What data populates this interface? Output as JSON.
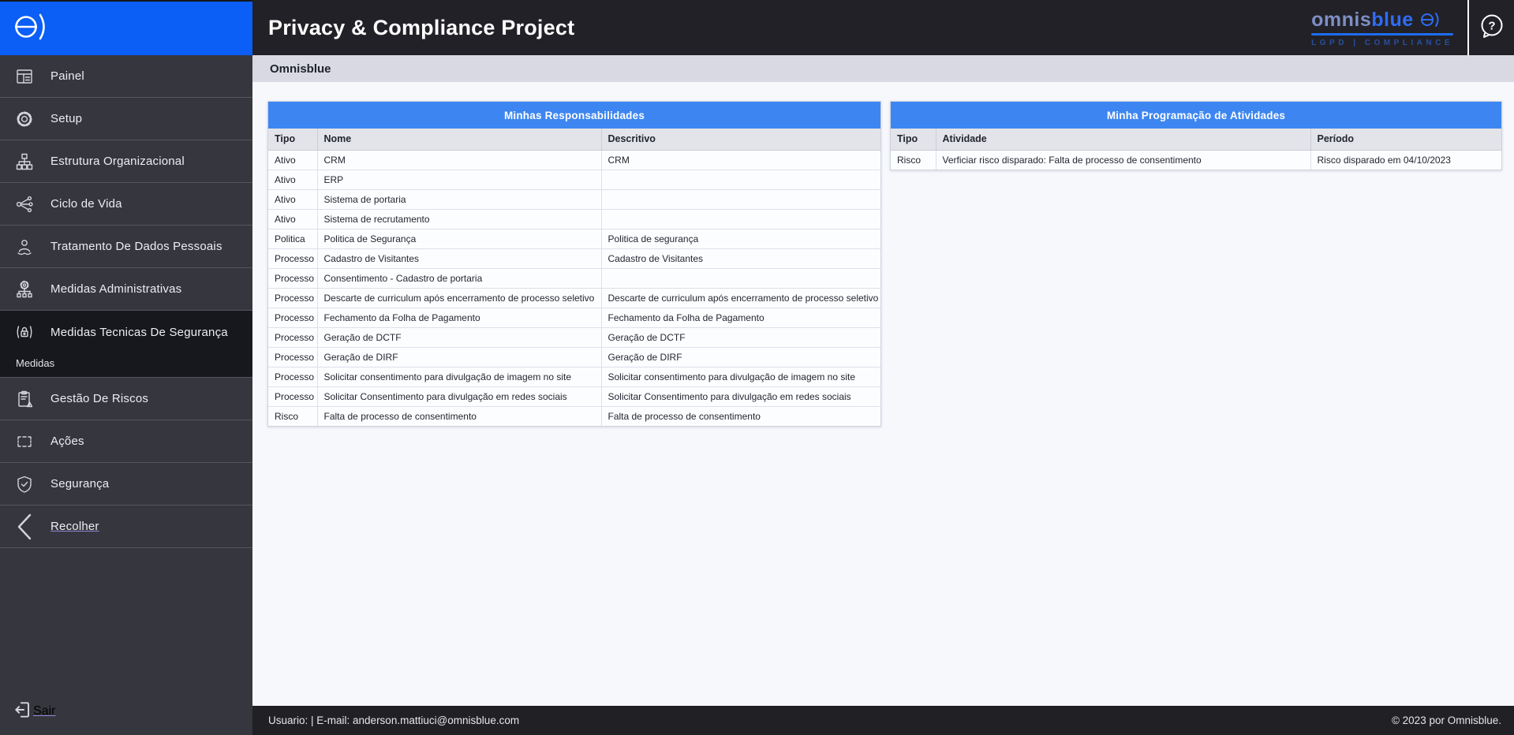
{
  "header": {
    "title": "Privacy & Compliance Project",
    "brand": {
      "name_part1": "omnis",
      "name_part2": "blue",
      "tagline": "LGPD  |  COMPLIANCE"
    }
  },
  "breadcrumb": "Omnisblue",
  "sidebar": {
    "items": [
      {
        "label": "Painel"
      },
      {
        "label": "Setup"
      },
      {
        "label": "Estrutura Organizacional"
      },
      {
        "label": "Ciclo de Vida"
      },
      {
        "label": "Tratamento De Dados Pessoais"
      },
      {
        "label": "Medidas Administrativas"
      },
      {
        "label": "Medidas Tecnicas De Segurança",
        "active": true,
        "subitem": "Medidas"
      },
      {
        "label": "Gestão De Riscos"
      },
      {
        "label": "Ações"
      },
      {
        "label": "Segurança"
      },
      {
        "label": "Recolher"
      },
      {
        "label": "Sair"
      }
    ]
  },
  "tables": [
    {
      "title": "Minhas Responsabilidades",
      "columns": [
        "Tipo",
        "Nome",
        "Descritivo"
      ],
      "rows": [
        [
          "Ativo",
          "CRM",
          "CRM"
        ],
        [
          "Ativo",
          "ERP",
          ""
        ],
        [
          "Ativo",
          "Sistema de portaria",
          ""
        ],
        [
          "Ativo",
          "Sistema de recrutamento",
          ""
        ],
        [
          "Politica",
          "Politica de Segurança",
          "Politica de segurança"
        ],
        [
          "Processo",
          "Cadastro de Visitantes",
          "Cadastro de Visitantes"
        ],
        [
          "Processo",
          "Consentimento - Cadastro de portaria",
          ""
        ],
        [
          "Processo",
          "Descarte de curriculum após encerramento de processo seletivo",
          "Descarte de curriculum após encerramento de processo seletivo"
        ],
        [
          "Processo",
          "Fechamento da Folha de Pagamento",
          "Fechamento da Folha de Pagamento"
        ],
        [
          "Processo",
          "Geração de DCTF",
          "Geração de DCTF"
        ],
        [
          "Processo",
          "Geração de DIRF",
          "Geração de DIRF"
        ],
        [
          "Processo",
          "Solicitar consentimento para divulgação de imagem no site",
          "Solicitar consentimento para divulgação de imagem no site"
        ],
        [
          "Processo",
          "Solicitar Consentimento para divulgação em redes sociais",
          "Solicitar Consentimento para divulgação em redes sociais"
        ],
        [
          "Risco",
          "Falta de processo de consentimento",
          "Falta de processo de consentimento"
        ]
      ]
    },
    {
      "title": "Minha Programação de Atividades",
      "columns": [
        "Tipo",
        "Atividade",
        "Período"
      ],
      "rows": [
        [
          "Risco",
          "Verficiar risco disparado: Falta de processo de consentimento",
          "Risco disparado em 04/10/2023"
        ]
      ]
    }
  ],
  "footer": {
    "user_info": "Usuario: | E-mail: anderson.mattiuci@omnisblue.com",
    "copyright": "© 2023 por Omnisblue."
  },
  "colors": {
    "brand_blue": "#0b5ef6",
    "table_header_blue": "#3d86f1",
    "sidebar_bg": "#36373e",
    "sidebar_active_bg": "#17181d",
    "header_bg": "#212127",
    "breadcrumb_bg": "#d8d9e3",
    "content_bg": "#f7f8fc",
    "footer_bg": "#202025"
  }
}
